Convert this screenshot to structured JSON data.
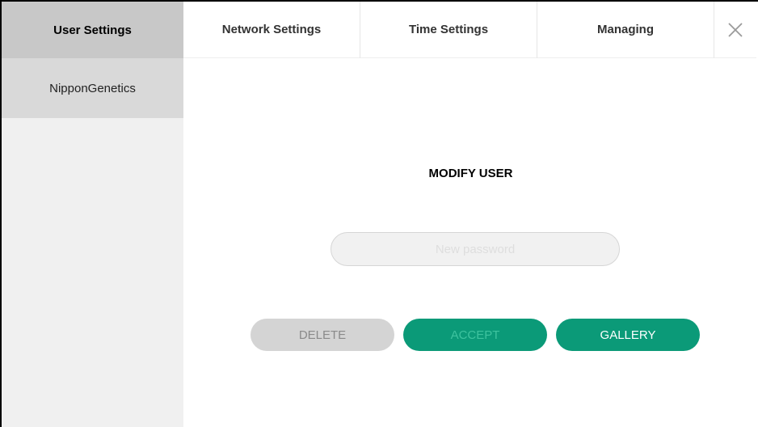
{
  "tabs": [
    {
      "label": "User Settings",
      "active": true
    },
    {
      "label": "Network Settings",
      "active": false
    },
    {
      "label": "Time Settings",
      "active": false
    },
    {
      "label": "Managing",
      "active": false
    }
  ],
  "close_icon": "close-x-icon",
  "sidebar": {
    "items": [
      {
        "label": "NipponGenetics",
        "selected": true
      }
    ]
  },
  "main": {
    "title": "MODIFY USER",
    "password_field": {
      "value": "",
      "placeholder": "New password"
    },
    "buttons": {
      "delete_label": "DELETE",
      "accept_label": "ACCEPT",
      "gallery_label": "GALLERY"
    }
  },
  "colors": {
    "accent": "#0b9a78",
    "active_tab_bg": "#c8c8c8",
    "sidebar_selected_bg": "#d9d9d9",
    "disabled_button_bg": "#d4d4d4"
  }
}
